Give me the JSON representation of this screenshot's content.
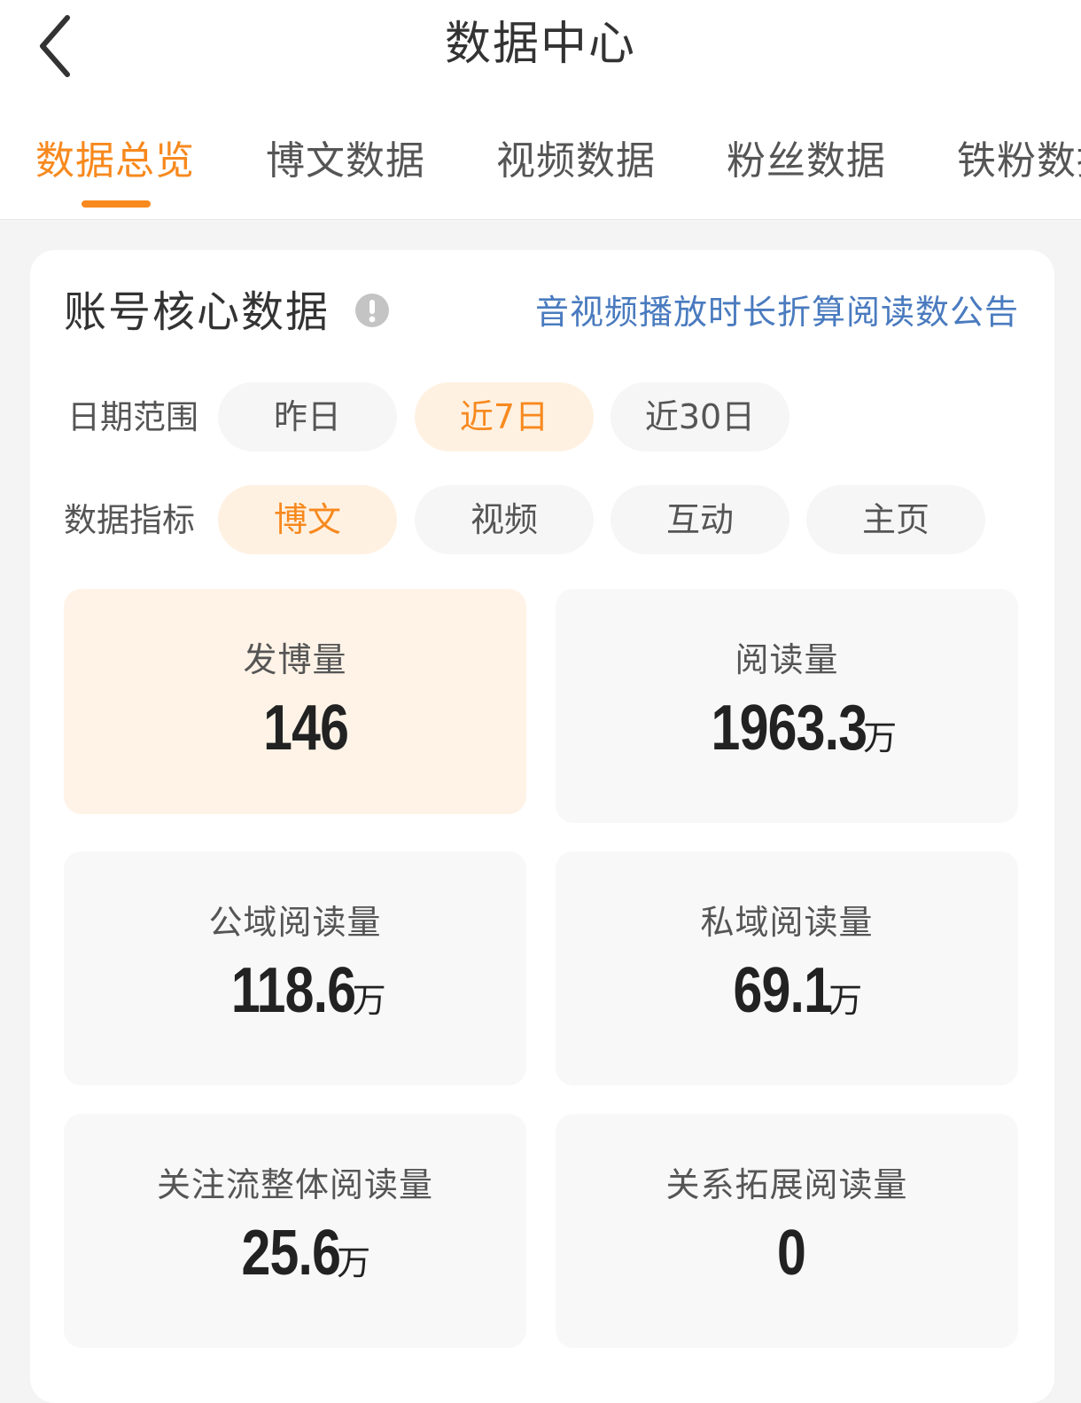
{
  "header": {
    "title": "数据中心",
    "back_icon": "chevron-left-icon"
  },
  "tabs": [
    {
      "label": "数据总览",
      "active": true
    },
    {
      "label": "博文数据",
      "active": false
    },
    {
      "label": "视频数据",
      "active": false
    },
    {
      "label": "粉丝数据",
      "active": false
    },
    {
      "label": "铁粉数据",
      "active": false
    }
  ],
  "core": {
    "title": "账号核心数据",
    "info_icon": "info-icon",
    "notice_link": "音视频播放时长折算阅读数公告"
  },
  "date_range": {
    "label": "日期范围",
    "options": [
      "昨日",
      "近7日",
      "近30日"
    ],
    "selected": "近7日"
  },
  "indicator": {
    "label": "数据指标",
    "options": [
      "博文",
      "视频",
      "互动",
      "主页"
    ],
    "selected": "博文"
  },
  "metrics": [
    {
      "label": "发博量",
      "value": "146",
      "unit": ""
    },
    {
      "label": "阅读量",
      "value": "1963.3",
      "unit": "万"
    },
    {
      "label": "公域阅读量",
      "value": "118.6",
      "unit": "万"
    },
    {
      "label": "私域阅读量",
      "value": "69.1",
      "unit": "万"
    },
    {
      "label": "关注流整体阅读量",
      "value": "25.6",
      "unit": "万"
    },
    {
      "label": "关系拓展阅读量",
      "value": "0",
      "unit": ""
    }
  ],
  "colors": {
    "accent": "#f7891e",
    "accent_bg": "#fff1e2",
    "link": "#4a7bbf",
    "text": "#333333"
  }
}
